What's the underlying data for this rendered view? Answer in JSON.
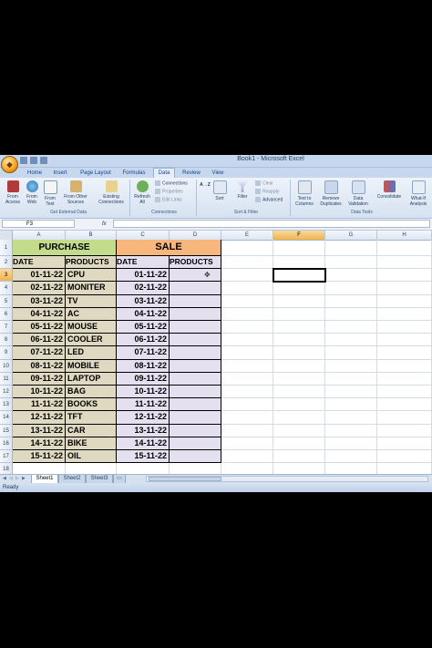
{
  "window": {
    "title": "Book1 - Microsoft Excel"
  },
  "ribbon_tabs": [
    "Home",
    "Insert",
    "Page Layout",
    "Formulas",
    "Data",
    "Review",
    "View"
  ],
  "active_tab": "Data",
  "ribbon": {
    "from_access": "From\nAccess",
    "from_web": "From\nWeb",
    "from_text": "From\nText",
    "from_other": "From Other\nSources",
    "existing": "Existing\nConnections",
    "refresh": "Refresh\nAll",
    "connections": "Connections",
    "properties": "Properties",
    "edit_links": "Edit Links",
    "sort_az": "A→Z",
    "sort": "Sort",
    "filter": "Filter",
    "clear": "Clear",
    "reapply": "Reapply",
    "advanced": "Advanced",
    "text_to_columns": "Text to\nColumns",
    "remove_duplicates": "Remove\nDuplicates",
    "data_validation": "Data\nValidation",
    "consolidate": "Consolidate",
    "what_if": "What-If\nAnalysis",
    "groups": {
      "external": "Get External Data",
      "connections": "Connections",
      "sort_filter": "Sort & Filter",
      "data_tools": "Data Tools"
    }
  },
  "formula_bar": {
    "name_box": "F3",
    "fx": "fx",
    "formula": ""
  },
  "columns": [
    "A",
    "B",
    "C",
    "D",
    "E",
    "F",
    "G",
    "H"
  ],
  "selected_column": "F",
  "rows": [
    "1",
    "2",
    "3",
    "4",
    "5",
    "6",
    "7",
    "8",
    "9",
    "10",
    "11",
    "12",
    "13",
    "14",
    "15",
    "16",
    "17",
    "18"
  ],
  "selected_row": "3",
  "sheet": {
    "purchase_header": "PURCHASE",
    "sale_header": "SALE",
    "col_date": "DATE",
    "col_products": "PRODUCTS",
    "purchase_dates": [
      "01-11-22",
      "02-11-22",
      "03-11-22",
      "04-11-22",
      "05-11-22",
      "06-11-22",
      "07-11-22",
      "08-11-22",
      "09-11-22",
      "10-11-22",
      "11-11-22",
      "12-11-22",
      "13-11-22",
      "14-11-22",
      "15-11-22"
    ],
    "purchase_products": [
      "CPU",
      "MONITER",
      "TV",
      "AC",
      "MOUSE",
      "COOLER",
      "LED",
      "MOBILE",
      "LAPTOP",
      "BAG",
      "BOOKS",
      "TFT",
      "CAR",
      "BIKE",
      "OIL"
    ],
    "sale_dates": [
      "01-11-22",
      "02-11-22",
      "03-11-22",
      "04-11-22",
      "05-11-22",
      "06-11-22",
      "07-11-22",
      "08-11-22",
      "09-11-22",
      "10-11-22",
      "11-11-22",
      "12-11-22",
      "13-11-22",
      "14-11-22",
      "15-11-22"
    ]
  },
  "sheet_tabs": [
    "Sheet1",
    "Sheet2",
    "Sheet3"
  ],
  "active_sheet": "Sheet1",
  "status": "Ready"
}
